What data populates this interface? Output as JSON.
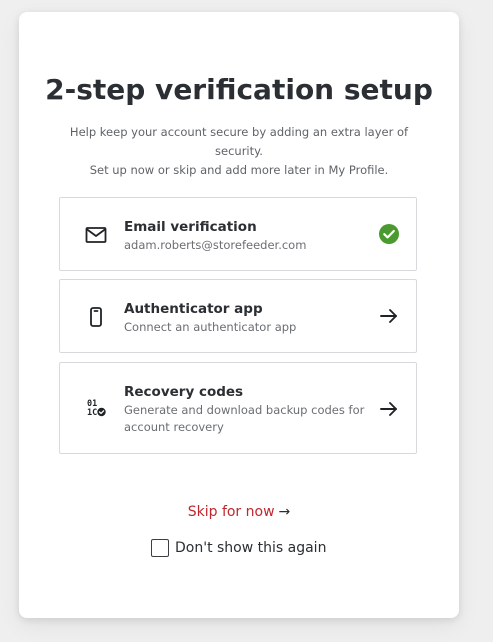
{
  "header": {
    "title": "2-step verification setup",
    "subtitle_line1": "Help keep your account secure by adding an extra layer of security.",
    "subtitle_line2": "Set up now or skip and add more later in My Profile."
  },
  "options": [
    {
      "title": "Email verification",
      "description": "adam.roberts@storefeeder.com",
      "icon": "mail-icon",
      "status": "completed",
      "status_icon": "check-circle-icon"
    },
    {
      "title": "Authenticator app",
      "description": "Connect an authenticator app",
      "icon": "smartphone-icon",
      "status_icon": "arrow-right-icon"
    },
    {
      "title": "Recovery codes",
      "description": "Generate and download backup codes for account recovery",
      "icon": "binary-codes-icon",
      "status_icon": "arrow-right-icon"
    }
  ],
  "footer": {
    "skip_label": "Skip for now",
    "skip_arrow": "→",
    "dont_show_label": "Don't show this again",
    "dont_show_checked": false
  },
  "colors": {
    "accent": "#c0262d",
    "success": "#4a9a2f",
    "text": "#2b2f33",
    "muted": "#6a6e73",
    "border": "#d7d9dc"
  }
}
